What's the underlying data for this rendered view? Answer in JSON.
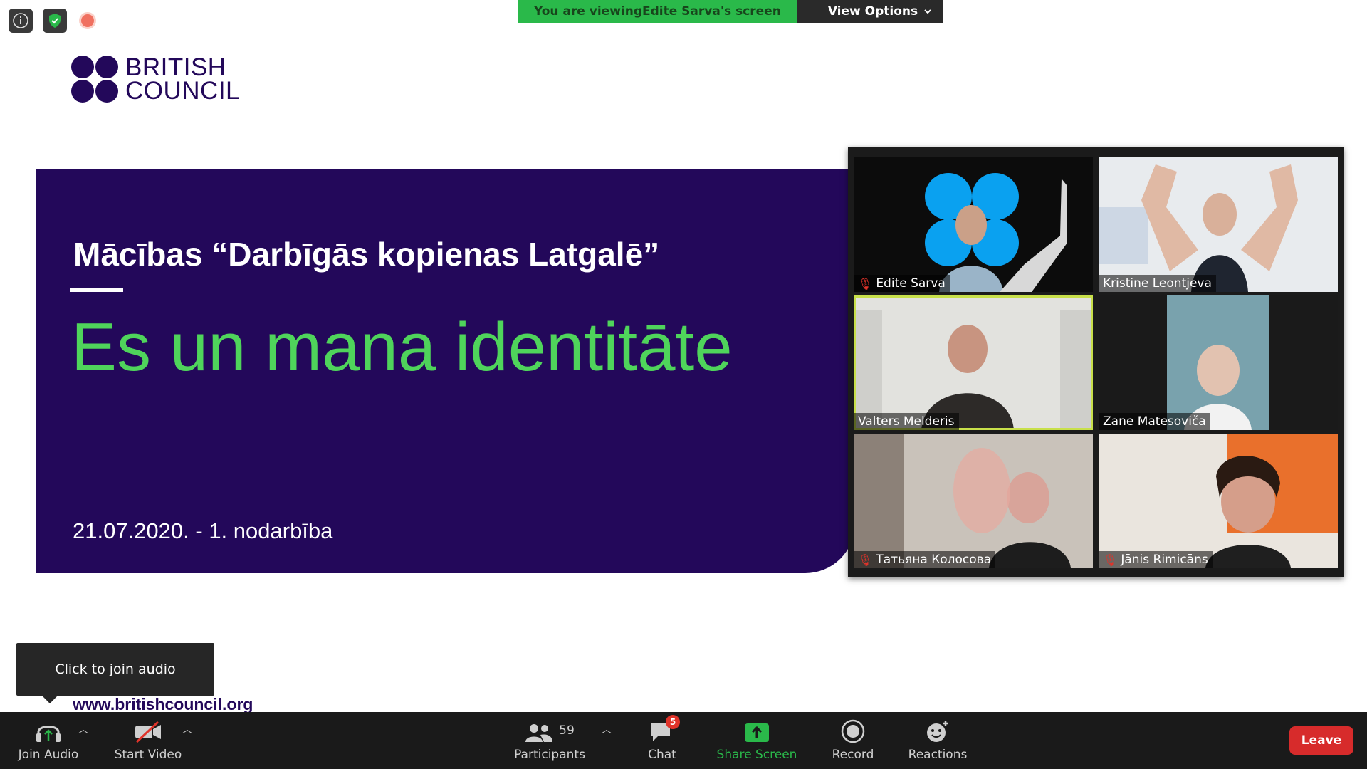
{
  "banner": {
    "viewing_prefix": "You are viewing ",
    "viewing_name": "Edite Sarva's screen",
    "view_options": "View Options"
  },
  "logo": {
    "line1": "BRITISH",
    "line2": "COUNCIL"
  },
  "slide": {
    "title": "Mācības “Darbīgās kopienas Latgalē”",
    "heading": "Es un mana identitāte",
    "date": "21.07.2020. - 1. nodarbība",
    "url": "www.britishcouncil.org"
  },
  "gallery": {
    "participants": [
      {
        "name": "Edite Sarva",
        "muted": true
      },
      {
        "name": "Kristine Leontjeva",
        "muted": false
      },
      {
        "name": "Valters Melderis",
        "muted": false
      },
      {
        "name": "Zane Matesoviča",
        "muted": false
      },
      {
        "name": "Татьяна Колосова",
        "muted": true
      },
      {
        "name": "Jānis Rimicāns",
        "muted": true
      }
    ]
  },
  "tooltip": {
    "text": "Click to join audio"
  },
  "toolbar": {
    "join_audio": "Join Audio",
    "start_video": "Start Video",
    "participants": "Participants",
    "participants_count": "59",
    "chat": "Chat",
    "chat_badge": "5",
    "share_screen": "Share Screen",
    "record": "Record",
    "reactions": "Reactions",
    "leave": "Leave"
  },
  "colors": {
    "brand_purple": "#23085a",
    "slide_green": "#4fd45b",
    "share_green": "#2ab94a",
    "leave_red": "#d72b2b"
  }
}
